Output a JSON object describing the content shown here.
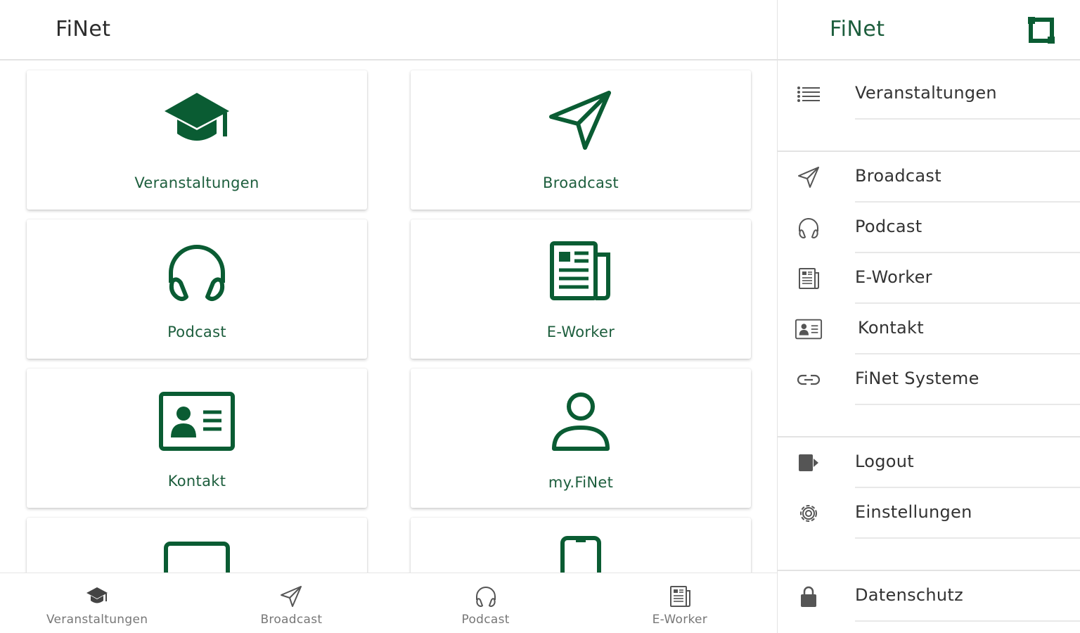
{
  "app": {
    "title": "FiNet"
  },
  "cards": [
    {
      "label": "Veranstaltungen",
      "icon": "graduation-cap-icon"
    },
    {
      "label": "Broadcast",
      "icon": "send-icon"
    },
    {
      "label": "Podcast",
      "icon": "headphones-icon"
    },
    {
      "label": "E-Worker",
      "icon": "newspaper-icon"
    },
    {
      "label": "Kontakt",
      "icon": "contact-card-icon"
    },
    {
      "label": "my.FiNet",
      "icon": "user-icon"
    },
    {
      "label": "",
      "icon": "tablet-icon"
    },
    {
      "label": "",
      "icon": "smartphone-icon"
    }
  ],
  "bottom_nav": [
    {
      "label": "Veranstaltungen",
      "icon": "graduation-cap-icon"
    },
    {
      "label": "Broadcast",
      "icon": "send-icon"
    },
    {
      "label": "Podcast",
      "icon": "headphones-icon"
    },
    {
      "label": "E-Worker",
      "icon": "newspaper-icon"
    }
  ],
  "drawer": {
    "title": "FiNet",
    "toggle_icon": "drawer-toggle-icon",
    "items": [
      {
        "label": "Veranstaltungen",
        "icon": "list-icon"
      },
      {
        "label": "Broadcast",
        "icon": "send-icon"
      },
      {
        "label": "Podcast",
        "icon": "headphones-icon"
      },
      {
        "label": "E-Worker",
        "icon": "newspaper-icon"
      },
      {
        "label": "Kontakt",
        "icon": "contact-card-icon"
      },
      {
        "label": "FiNet Systeme",
        "icon": "link-icon"
      },
      {
        "label": "Logout",
        "icon": "logout-icon"
      },
      {
        "label": "Einstellungen",
        "icon": "gear-icon"
      },
      {
        "label": "Datenschutz",
        "icon": "lock-icon"
      }
    ]
  },
  "colors": {
    "brand_green": "#0a5c33",
    "label_green": "#1d5e3d",
    "muted": "#777777"
  }
}
